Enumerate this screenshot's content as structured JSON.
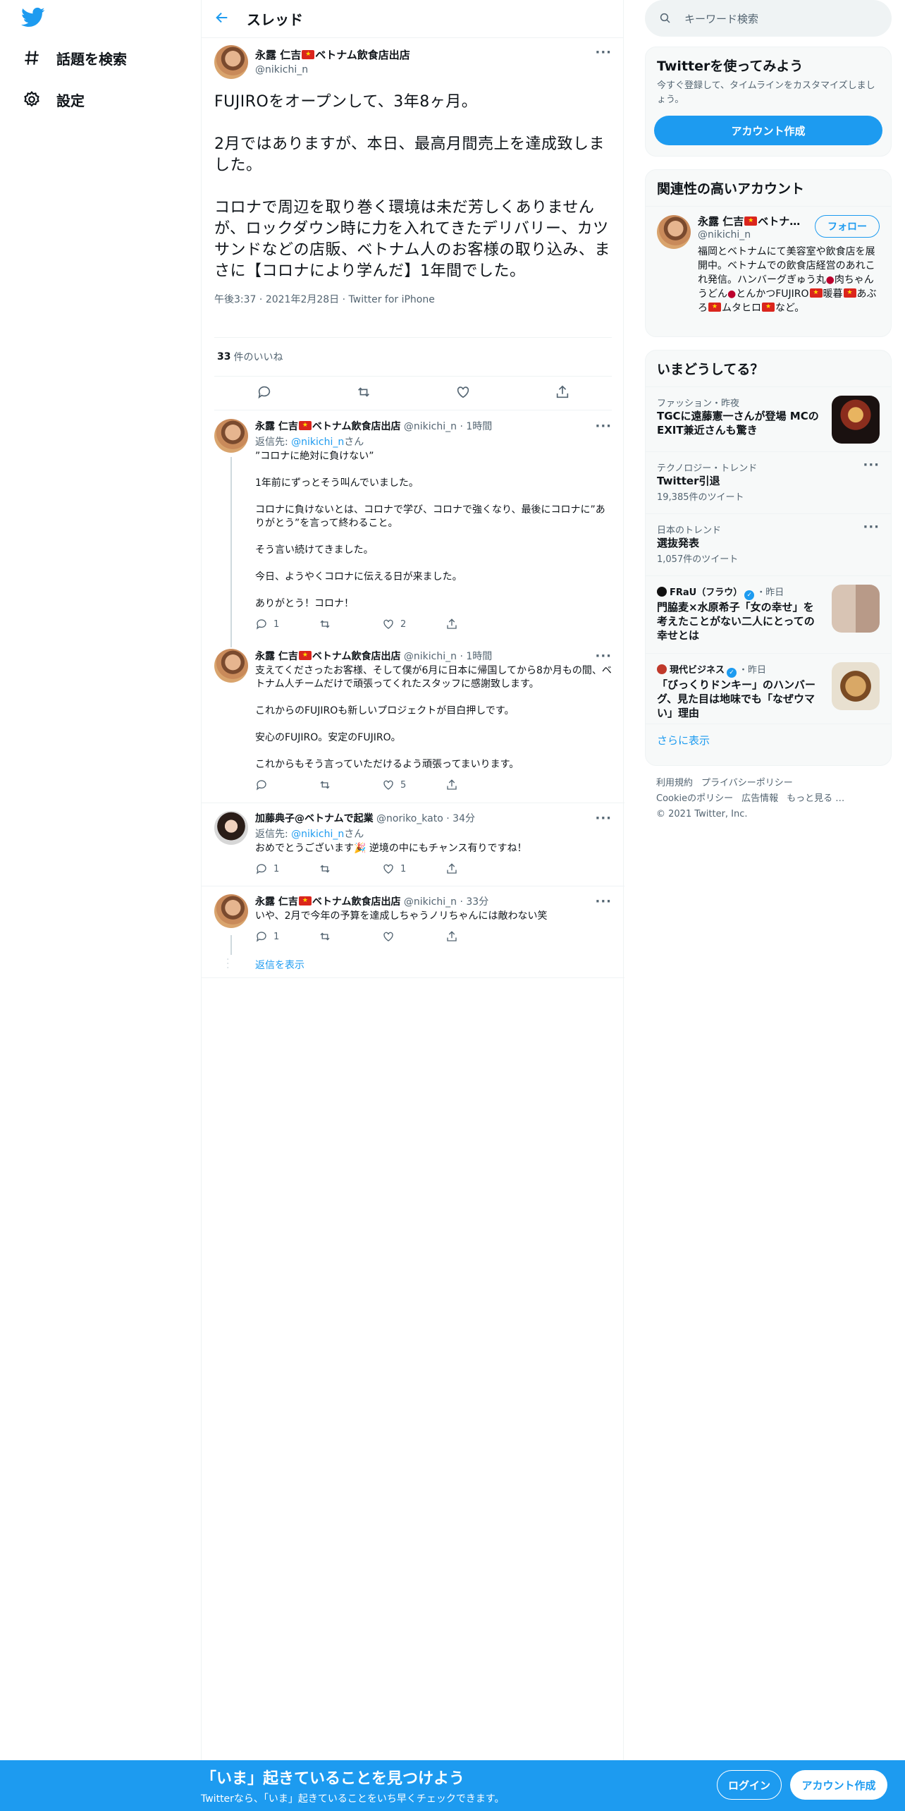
{
  "nav": {
    "explore_label": "話題を検索",
    "settings_label": "設定"
  },
  "header": {
    "title": "スレッド"
  },
  "focal_tweet": {
    "name": "永露 仁吉",
    "name_suffix": "ベトナム飲食店出店",
    "handle": "@nikichi_n",
    "text": "FUJIROをオープンして、3年8ヶ月。\n\n2月ではありますが、本日、最高月間売上を達成致しました。\n\nコロナで周辺を取り巻く環境は未だ芳しくありませんが、ロックダウン時に力を入れてきたデリバリー、カツサンドなどの店販、ベトナム人のお客様の取り込み、まさに【コロナにより学んだ】1年間でした。",
    "time": "午後3:37",
    "date": "2021年2月28日",
    "client": "Twitter for iPhone",
    "likes_count": "33",
    "likes_label": "件のいいね"
  },
  "replies": [
    {
      "name": "永露 仁吉",
      "name_suffix": "ベトナム飲食店出店",
      "handle": "@nikichi_n",
      "time": "1時間",
      "reply_to_label": "返信先:",
      "reply_to_handle": "@nikichi_n",
      "reply_to_suffix": "さん",
      "text": "”コロナに絶対に負けない”\n\n1年前にずっとそう叫んでいました。\n\nコロナに負けないとは、コロナで学び、コロナで強くなり、最後にコロナに”ありがとう”を言って終わること。\n\nそう言い続けてきました。\n\n今日、ようやくコロナに伝える日が来ました。\n\nありがとう！コロナ！",
      "reply_count": "1",
      "retweet_count": "",
      "like_count": "2"
    },
    {
      "name": "永露 仁吉",
      "name_suffix": "ベトナム飲食店出店",
      "handle": "@nikichi_n",
      "time": "1時間",
      "text": "支えてくださったお客様、そして僕が6月に日本に帰国してから8か月もの間、ベトナム人チームだけで頑張ってくれたスタッフに感謝致します。\n\nこれからのFUJIROも新しいプロジェクトが目白押しです。\n\n安心のFUJIRO。安定のFUJIRO。\n\nこれからもそう言っていただけるよう頑張ってまいります。",
      "reply_count": "",
      "retweet_count": "",
      "like_count": "5"
    },
    {
      "name": "加藤典子@ベトナムで起業",
      "handle": "@noriko_kato",
      "time": "34分",
      "reply_to_label": "返信先:",
      "reply_to_handle": "@nikichi_n",
      "reply_to_suffix": "さん",
      "text_before": "おめでとうございます",
      "text_after": " 逆境の中にもチャンス有りですね！",
      "reply_count": "1",
      "retweet_count": "",
      "like_count": "1"
    },
    {
      "name": "永露 仁吉",
      "name_suffix": "ベトナム飲食店出店",
      "handle": "@nikichi_n",
      "time": "33分",
      "text": "いや、2月で今年の予算を達成しちゃうノリちゃんには敵わない笑",
      "reply_count": "1",
      "retweet_count": "",
      "like_count": ""
    }
  ],
  "show_replies_label": "返信を表示",
  "search": {
    "placeholder": "キーワード検索"
  },
  "signup_card": {
    "title": "Twitterを使ってみよう",
    "desc": "今すぐ登録して、タイムラインをカスタマイズしましょう。",
    "button": "アカウント作成"
  },
  "related": {
    "title": "関連性の高いアカウント",
    "name": "永露 仁吉",
    "name_suffix": "ベトナ…",
    "handle": "@nikichi_n",
    "follow_label": "フォロー",
    "bio_1": "福岡とベトナムにて美容室や飲食店を展開中。ベトナムでの飲食店経営のあれこれ発信。ハンバーグぎゅう丸",
    "bio_2": "肉ちゃんうどん",
    "bio_3": "とんかつFUJIRO",
    "bio_4": "暖暮",
    "bio_5": "あぶろ",
    "bio_6": "ムタヒロ",
    "bio_7": "など。"
  },
  "trends": {
    "title": "いまどうしてる？",
    "items": [
      {
        "category": "ファッション・昨夜",
        "title": "TGCに遠藤憲一さんが登場 MCのEXIT兼近さんも驚き"
      },
      {
        "category": "テクノロジー・トレンド",
        "title": "Twitter引退",
        "count": "19,385件のツイート"
      },
      {
        "category": "日本のトレンド",
        "title": "選抜発表",
        "count": "1,057件のツイート"
      },
      {
        "source": "FRaU（フラウ）",
        "time": "・昨日",
        "title": "門脇麦×水原希子「女の幸せ」を考えたことがない二人にとっての幸せとは"
      },
      {
        "source": "現代ビジネス",
        "time": "・昨日",
        "title": "「びっくりドンキー」のハンバーグ、見た目は地味でも「なぜウマい」理由"
      }
    ],
    "show_more": "さらに表示"
  },
  "footer": {
    "terms": "利用規約",
    "privacy": "プライバシーポリシー",
    "cookie": "Cookieのポリシー",
    "ads": "広告情報",
    "more": "もっと見る …",
    "copyright": "© 2021 Twitter, Inc."
  },
  "bottom_bar": {
    "headline": "「いま」起きていることを見つけよう",
    "sub": "Twitterなら、「いま」起きていることをいち早くチェックできます。",
    "login": "ログイン",
    "signup": "アカウント作成"
  },
  "colors": {
    "accent": "#1d9bf0",
    "text": "#0f1419",
    "muted": "#536471"
  }
}
